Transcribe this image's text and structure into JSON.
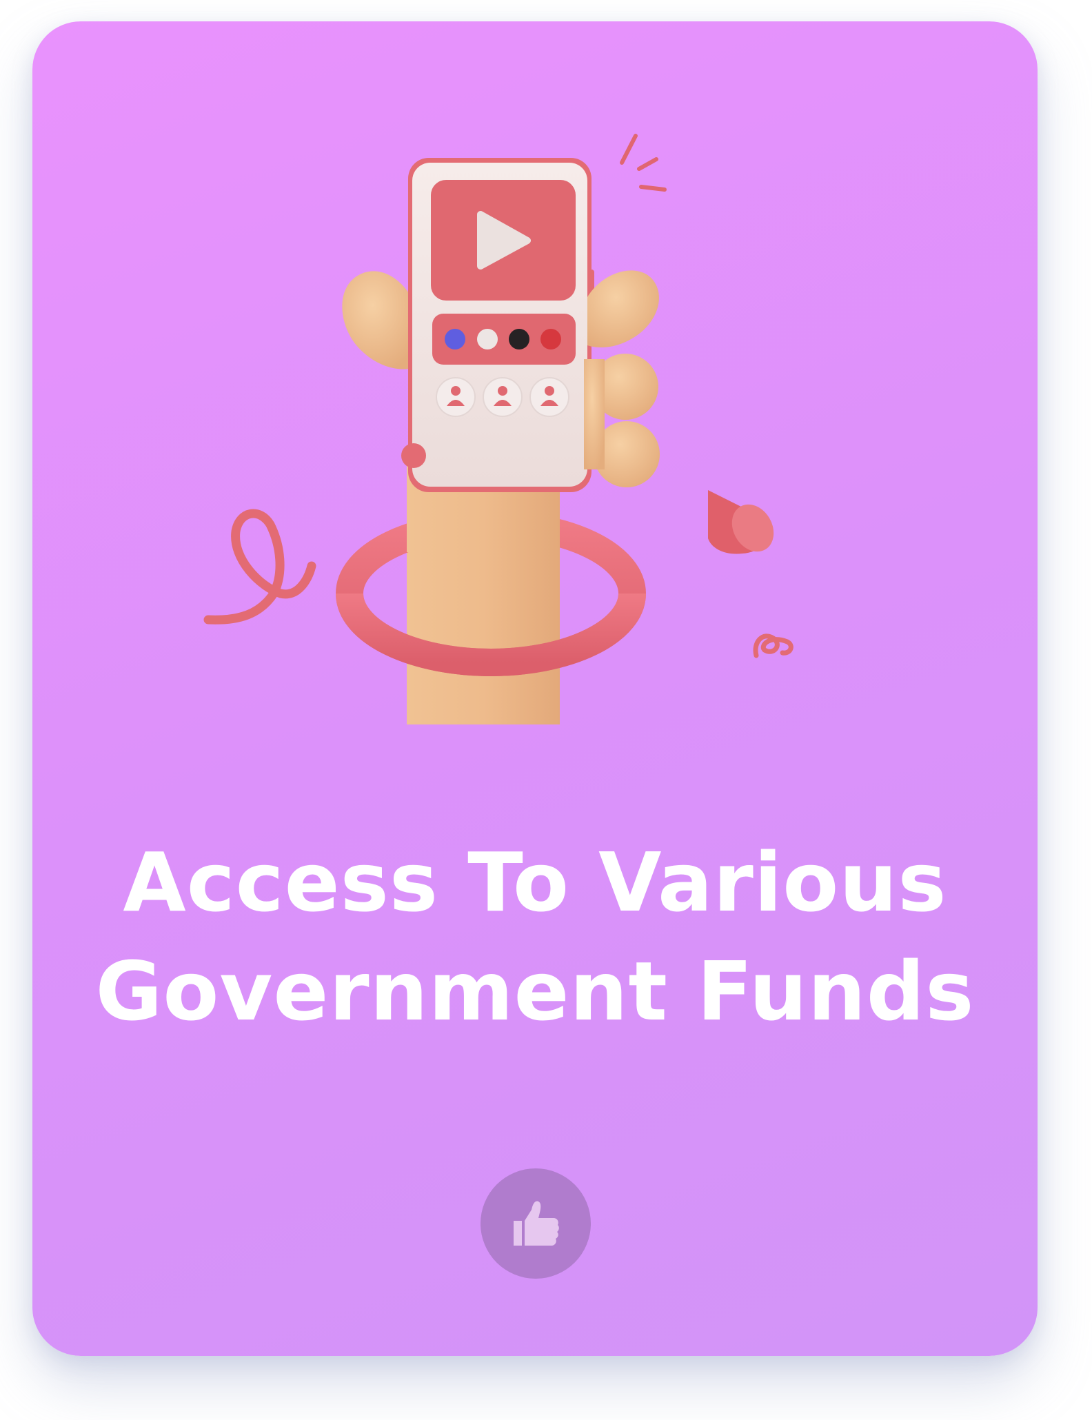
{
  "card": {
    "title_line_1": "Access To Various",
    "title_line_2": "Government Funds",
    "illustration_icon": "hand-holding-phone-video-illustration",
    "like_icon": "thumbs-up-icon"
  },
  "colors": {
    "card_gradient_start": "#e992fd",
    "card_gradient_end": "#d294f8",
    "title_text": "#ffffff",
    "like_button_bg": "#b07ccd",
    "like_icon": "#e6c7ef",
    "phone_accent": "#e36b73",
    "skin": "#eebb8c"
  }
}
